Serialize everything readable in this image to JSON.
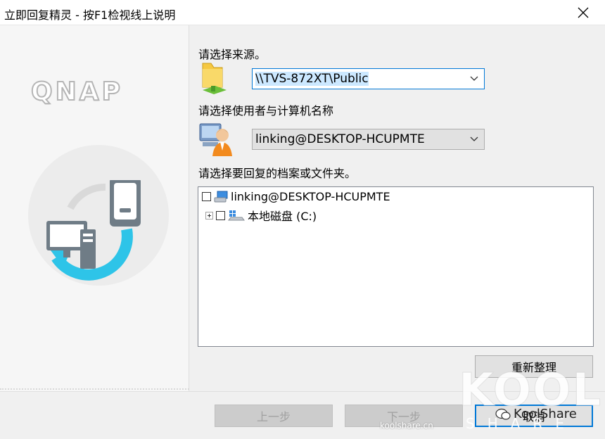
{
  "window": {
    "title": "立即回复精灵 - 按F1检视线上说明"
  },
  "brand": {
    "logo_text": "QNAP"
  },
  "source": {
    "label": "请选择来源。",
    "value": "\\\\TVS-872XT\\Public"
  },
  "user": {
    "label": "请选择使用者与计算机名称",
    "value": "linking@DESKTOP-HCUPMTE"
  },
  "files": {
    "label": "请选择要回复的档案或文件夹。",
    "tree": [
      {
        "label": "linking@DESKTOP-HCUPMTE"
      },
      {
        "label": "本地磁盘 (C:)"
      }
    ]
  },
  "buttons": {
    "refresh": "重新整理",
    "back": "上一步",
    "next": "下一步",
    "cancel": "取消"
  },
  "watermark": {
    "kool": "KOOL",
    "share": "SHARE",
    "handle": "KoolShare",
    "url": "koolshare.cn"
  }
}
